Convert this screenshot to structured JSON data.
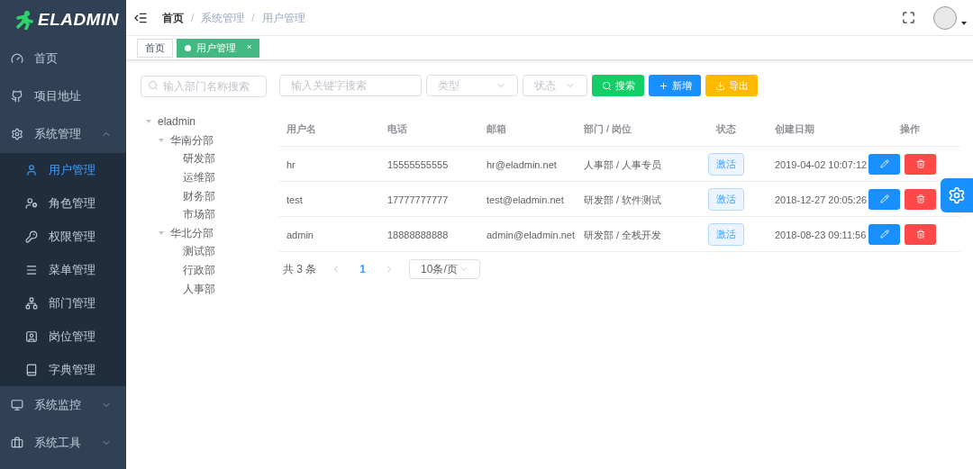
{
  "logo": {
    "text": "ELADMIN"
  },
  "sidebar": {
    "items": [
      {
        "label": "首页"
      },
      {
        "label": "项目地址"
      },
      {
        "label": "系统管理",
        "expanded": true,
        "children": [
          {
            "label": "用户管理",
            "selected": true
          },
          {
            "label": "角色管理",
            "selected": false
          },
          {
            "label": "权限管理",
            "selected": false
          },
          {
            "label": "菜单管理",
            "selected": false
          },
          {
            "label": "部门管理",
            "selected": false
          },
          {
            "label": "岗位管理",
            "selected": false
          },
          {
            "label": "字典管理",
            "selected": false
          }
        ]
      },
      {
        "label": "系统监控",
        "expanded": false
      },
      {
        "label": "系统工具",
        "expanded": false
      }
    ]
  },
  "breadcrumb": {
    "separator": "/",
    "items": [
      "首页",
      "系统管理",
      "用户管理"
    ]
  },
  "tags": [
    {
      "label": "首页",
      "selected": false
    },
    {
      "label": "用户管理",
      "selected": true,
      "close": "×"
    }
  ],
  "dept_search": {
    "placeholder": "输入部门名称搜索"
  },
  "dept_tree": [
    {
      "label": "eladmin",
      "expanded": true,
      "children": [
        {
          "label": "华南分部",
          "expanded": true,
          "children": [
            {
              "label": "研发部"
            },
            {
              "label": "运维部"
            },
            {
              "label": "财务部"
            },
            {
              "label": "市场部"
            }
          ]
        },
        {
          "label": "华北分部",
          "expanded": true,
          "children": [
            {
              "label": "测试部"
            },
            {
              "label": "行政部"
            },
            {
              "label": "人事部"
            }
          ]
        }
      ]
    }
  ],
  "toolbar": {
    "keyword": {
      "placeholder": "输入关键字搜索"
    },
    "type_select": {
      "placeholder": "类型"
    },
    "status_select": {
      "placeholder": "状态"
    },
    "buttons": [
      {
        "label": "搜索",
        "kind": "search"
      },
      {
        "label": "新增",
        "kind": "add"
      },
      {
        "label": "导出",
        "kind": "export"
      }
    ]
  },
  "table": {
    "columns": [
      "用户名",
      "电话",
      "邮箱",
      "部门 / 岗位",
      "状态",
      "创建日期",
      "操作"
    ],
    "rows": [
      {
        "username": "hr",
        "phone": "15555555555",
        "email": "hr@eladmin.net",
        "dept": "人事部 / 人事专员",
        "status": "激活",
        "created": "2019-04-02 10:07:12"
      },
      {
        "username": "test",
        "phone": "17777777777",
        "email": "test@eladmin.net",
        "dept": "研发部 / 软件测试",
        "status": "激活",
        "created": "2018-12-27 20:05:26"
      },
      {
        "username": "admin",
        "phone": "18888888888",
        "email": "admin@eladmin.net",
        "dept": "研发部 / 全栈开发",
        "status": "激活",
        "created": "2018-08-23 09:11:56"
      }
    ]
  },
  "pagination": {
    "total": "共 3 条",
    "pages": [
      {
        "label": "1",
        "selected": true
      }
    ],
    "page_size": "10条/页"
  }
}
